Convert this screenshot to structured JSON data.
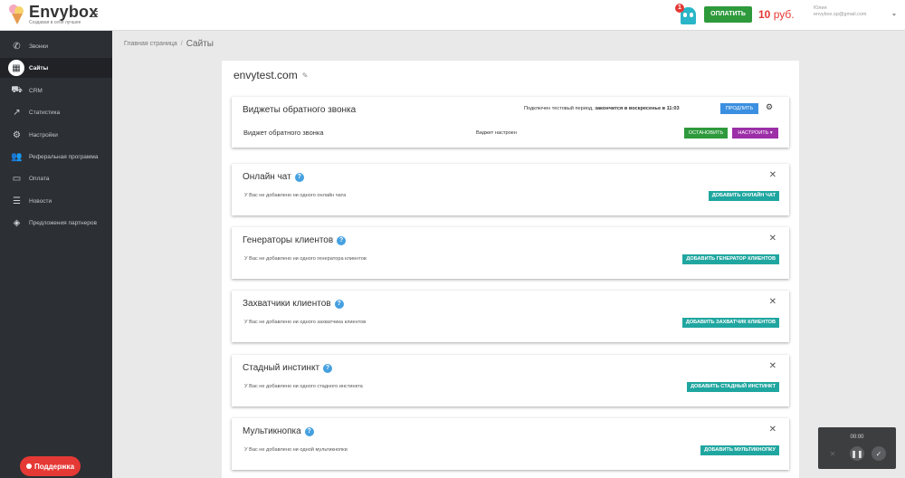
{
  "header": {
    "logo_name": "Envybox",
    "logo_tagline": "Создавая в себя лучшее",
    "notification_count": "1",
    "pay_label": "ОПЛАТИТЬ",
    "balance_value": "10",
    "balance_currency": "руб.",
    "user_name": "Юлия",
    "user_email": "envybox.sp@gmail.com"
  },
  "sidebar": {
    "items": [
      {
        "label": "Звонки",
        "icon": "phone-icon"
      },
      {
        "label": "Сайты",
        "icon": "grid-icon",
        "active": true
      },
      {
        "label": "CRM",
        "icon": "crm-icon"
      },
      {
        "label": "Статистика",
        "icon": "chart-line-icon"
      },
      {
        "label": "Настройки",
        "icon": "gear-icon"
      },
      {
        "label": "Реферальная программа",
        "icon": "users-icon"
      },
      {
        "label": "Оплата",
        "icon": "card-icon"
      },
      {
        "label": "Новости",
        "icon": "list-icon"
      },
      {
        "label": "Предложения партнеров",
        "icon": "tag-icon"
      }
    ],
    "support_label": "Поддержка"
  },
  "breadcrumb": {
    "home": "Главная страница",
    "separator": "/",
    "current": "Сайты"
  },
  "site": {
    "domain": "envytest.com"
  },
  "callback": {
    "title": "Виджеты обратного звонка",
    "trial_text": "Подключен тестовый период,",
    "trial_end": "закончится в воскресенье в 11:03",
    "extend_label": "ПРОДЛИТЬ",
    "widget_name": "Виджет обратного звонка",
    "widget_status": "Виджет настроен",
    "stop_label": "ОСТАНОВИТЬ",
    "configure_label": "НАСТРОИТЬ ▾"
  },
  "sections": [
    {
      "title": "Онлайн чат",
      "empty_text": "У Вас не добавлено ни одного онлайн чата",
      "button": "ДОБАВИТЬ ОНЛАЙН ЧАТ"
    },
    {
      "title": "Генераторы клиентов",
      "empty_text": "У Вас не добавлено ни одного генератора клиентов",
      "button": "ДОБАВИТЬ ГЕНЕРАТОР КЛИЕНТОВ"
    },
    {
      "title": "Захватчики клиентов",
      "empty_text": "У Вас не добавлено ни одного захватчика клиентов",
      "button": "ДОБАВИТЬ ЗАХВАТЧИК КЛИЕНТОВ"
    },
    {
      "title": "Стадный инстинкт",
      "empty_text": "У Вас не добавлено ни одного стадного инстинкта",
      "button": "ДОБАВИТЬ СТАДНЫЙ ИНСТИНКТ"
    },
    {
      "title": "Мультикнопка",
      "empty_text": "У Вас не добавлено ни одной мультикнопки",
      "button": "ДОБАВИТЬ МУЛЬТИКНОПКУ"
    }
  ],
  "recorder": {
    "time": "00:00"
  },
  "colors": {
    "sidebar_bg": "#2c2f34",
    "teal": "#20a6a0",
    "green": "#2e9a3c",
    "purple": "#9c2fa8",
    "blue": "#3b8fe0",
    "red": "#e53935"
  }
}
